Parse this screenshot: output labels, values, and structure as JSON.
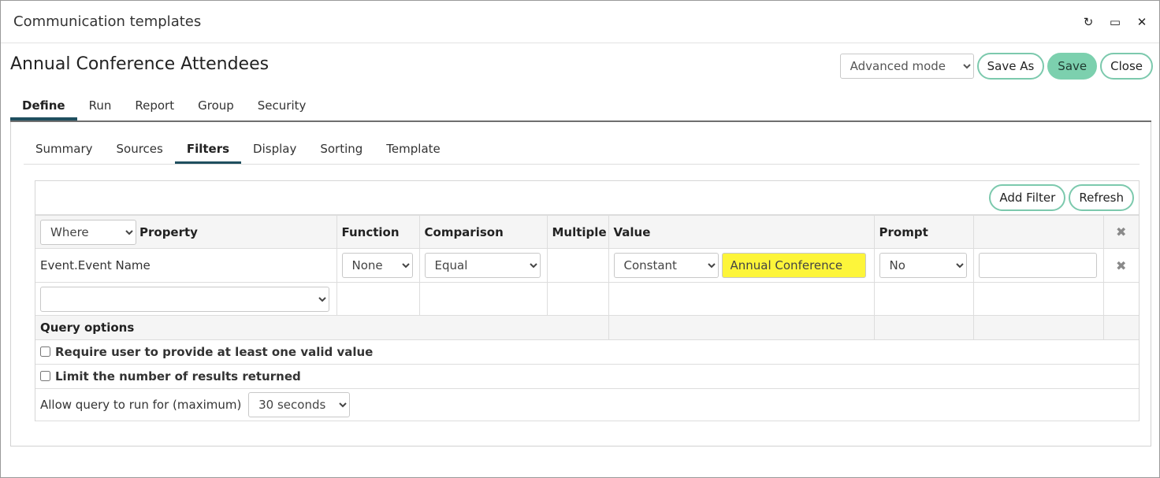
{
  "window": {
    "title": "Communication templates",
    "controls": [
      "refresh-icon",
      "maximize-icon",
      "close-icon"
    ],
    "control_glyphs": [
      "↻",
      "▭",
      "✕"
    ]
  },
  "heading": {
    "title": "Annual Conference Attendees",
    "mode_select": "Advanced mode",
    "save_as": "Save As",
    "save": "Save",
    "close": "Close"
  },
  "main_tabs": [
    "Define",
    "Run",
    "Report",
    "Group",
    "Security"
  ],
  "main_tab_active": "Define",
  "sub_tabs": [
    "Summary",
    "Sources",
    "Filters",
    "Display",
    "Sorting",
    "Template"
  ],
  "sub_tab_active": "Filters",
  "filters": {
    "add_filter": "Add Filter",
    "refresh": "Refresh",
    "where_select": "Where",
    "columns": {
      "property": "Property",
      "function": "Function",
      "comparison": "Comparison",
      "multiple": "Multiple",
      "value": "Value",
      "prompt": "Prompt"
    },
    "rows": [
      {
        "property": "Event.Event Name",
        "function": "None",
        "comparison": "Equal",
        "value_type": "Constant",
        "value": "Annual Conference",
        "prompt": "No"
      }
    ],
    "delete_glyph": "✖"
  },
  "query_options": {
    "heading": "Query options",
    "require_value": "Require user to provide at least one valid value",
    "limit_results": "Limit the number of results returned",
    "allow_query_label": "Allow query to run for (maximum)",
    "allow_query_value": "30 seconds"
  },
  "colors": {
    "accent": "#7cd0ae",
    "tab_underline": "#1f4f5f",
    "highlight": "#fdf53a"
  }
}
